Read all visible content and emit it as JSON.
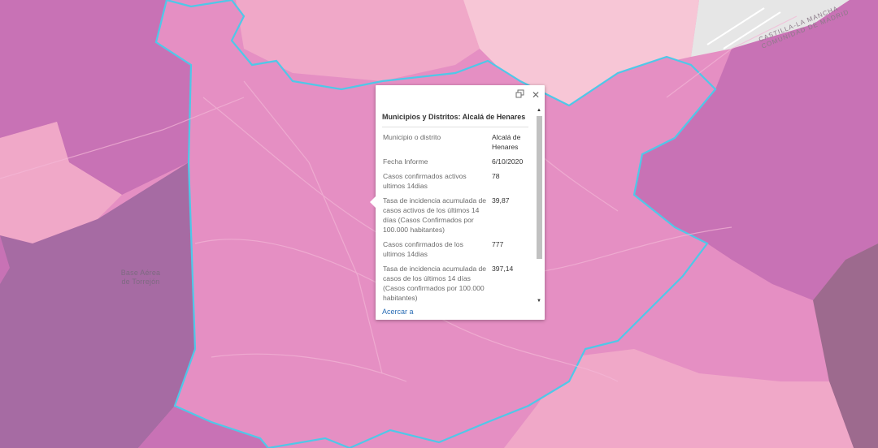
{
  "map": {
    "labels": {
      "base_aerea_line1": "Base Aérea",
      "base_aerea_line2": "de Torrejón",
      "region_line1": "CASTILLA-LA MANCHA",
      "region_line2": "COMUNIDAD DE MADRID"
    },
    "colors": {
      "selected_municipality": "#e58fc3",
      "high_incidence": "#c872b5",
      "low_incidence": "#f0a8c8",
      "very_low_incidence": "#f7c6d6",
      "torrejon": "#a66ba3",
      "outline_highlight": "#4fc8e8"
    }
  },
  "popup": {
    "title": "Municipios y Distritos: Alcalá de Henares",
    "dock_icon": "dock-icon",
    "close_icon": "close-icon",
    "attributes": [
      {
        "name": "Municipio o distrito",
        "value": "Alcalá de Henares"
      },
      {
        "name": "Fecha Informe",
        "value": "6/10/2020"
      },
      {
        "name": "Casos confirmados activos ultimos 14dias",
        "value": "78"
      },
      {
        "name": "Tasa de incidencia acumulada de casos activos de los últimos 14 días (Casos Confirmados por 100.000 habitantes)",
        "value": "39,87"
      },
      {
        "name": "Casos confirmados de los ultimos 14dias",
        "value": "777"
      },
      {
        "name": "Tasa de incidencia acumulada de casos de los últimos 14 días (Casos confirmados por 100.000 habitantes)",
        "value": "397,14"
      }
    ],
    "zoom_link": "Acercar a"
  }
}
